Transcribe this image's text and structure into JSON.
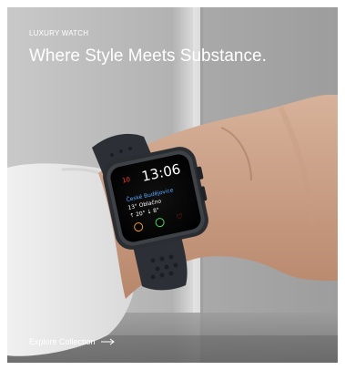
{
  "hero": {
    "eyebrow": "LUXURY WATCH",
    "headline": "Where Style Meets Substance.",
    "cta_label": "Explore Collection",
    "cta_icon": "arrow-right-icon"
  },
  "watch_face": {
    "time": "13:06",
    "date_day": "10",
    "location": "České Budějovice",
    "weather_line_1": "13° Oblačno",
    "weather_line_2": "↑ 20° ↓ 8°"
  },
  "colors": {
    "text": "#ffffff",
    "watch_accent": "#ff3b30",
    "location_blue": "#5aa9ff",
    "band": "#2c3036"
  }
}
